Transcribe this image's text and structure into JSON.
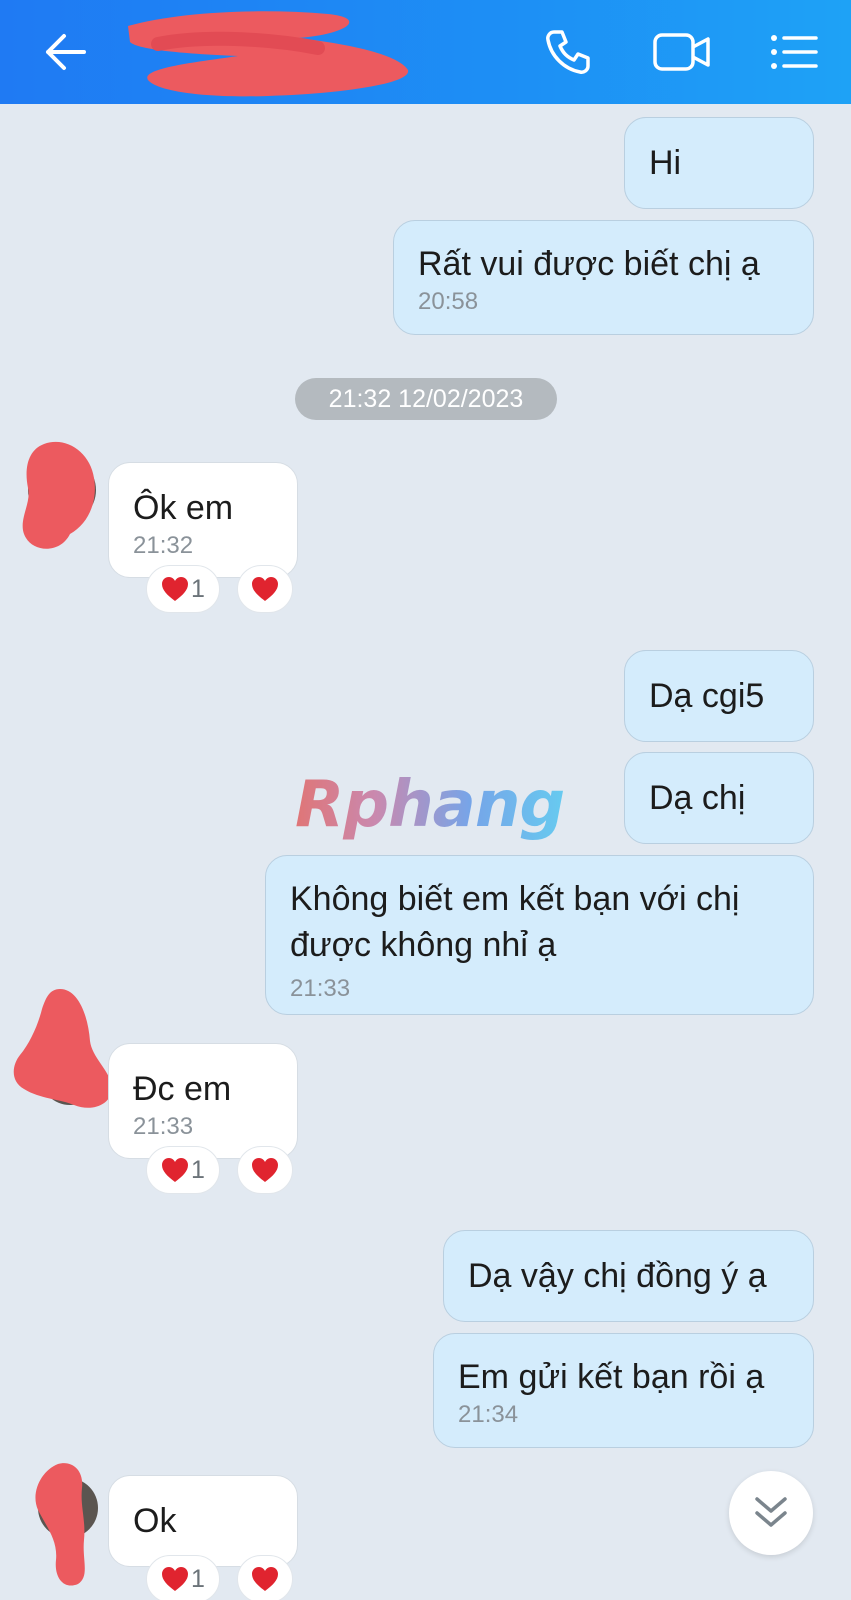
{
  "header": {
    "back_icon": "arrow-left-icon",
    "call_icon": "phone-icon",
    "video_icon": "video-camera-icon",
    "menu_icon": "list-menu-icon",
    "background_color": "#1e8cf4"
  },
  "messages": [
    {
      "text": "Hi"
    },
    {
      "text": "Rất vui được biết chị ạ",
      "time": "20:58"
    },
    {
      "text": "Ôk em",
      "time": "21:32",
      "reaction_count": "1"
    },
    {
      "text": "Dạ cgi5"
    },
    {
      "text": "Dạ chị"
    },
    {
      "text_line1": "Không biết em kết bạn với chị",
      "text_line2": "được không nhỉ ạ",
      "time": "21:33"
    },
    {
      "text": "Đc em",
      "time": "21:33",
      "reaction_count": "1"
    },
    {
      "text": "Dạ vậy chị đồng ý ạ"
    },
    {
      "text": "Em gửi kết bạn rồi ạ",
      "time": "21:34"
    },
    {
      "text": "Ok",
      "reaction_count": "1"
    }
  ],
  "date_separator": "21:32 12/02/2023",
  "watermark": "Rphang",
  "scroll_down_icon": "double-chevron-down-icon",
  "colors": {
    "outgoing_bubble": "#d4ecfc",
    "incoming_bubble": "#ffffff",
    "chat_background": "#e2e9f1",
    "heart": "#e0242f"
  }
}
